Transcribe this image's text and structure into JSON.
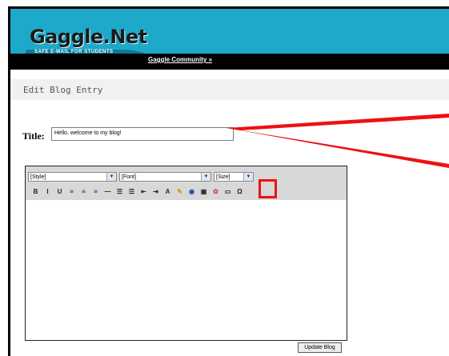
{
  "app": {
    "logo_text": "Gaggle.Net",
    "logo_tagline": "SAFE E-MAIL FOR STUDENTS",
    "nav_link": "Gaggle Community »"
  },
  "page": {
    "section_title": "Edit Blog Entry"
  },
  "form": {
    "title_label": "Title:",
    "title_value": "Hello, welcome to my blog!"
  },
  "editor": {
    "style_select": "[Style]",
    "font_select": "[Font]",
    "size_select": "[Size]",
    "dropdown_arrow": "▼",
    "toolbar_icons": [
      {
        "name": "bold-icon",
        "glyph": "B"
      },
      {
        "name": "italic-icon",
        "glyph": "I"
      },
      {
        "name": "underline-icon",
        "glyph": "U"
      },
      {
        "name": "align-left-icon",
        "glyph": "≡"
      },
      {
        "name": "align-center-icon",
        "glyph": "≡"
      },
      {
        "name": "align-right-icon",
        "glyph": "≡"
      },
      {
        "name": "horizontal-rule-icon",
        "glyph": "—"
      },
      {
        "name": "ordered-list-icon",
        "glyph": "☰"
      },
      {
        "name": "unordered-list-icon",
        "glyph": "☰"
      },
      {
        "name": "outdent-icon",
        "glyph": "⇤"
      },
      {
        "name": "indent-icon",
        "glyph": "⇥"
      },
      {
        "name": "text-color-icon",
        "glyph": "A"
      },
      {
        "name": "highlight-color-icon",
        "glyph": "✎"
      },
      {
        "name": "insert-link-icon",
        "glyph": "◉"
      },
      {
        "name": "insert-image-icon",
        "glyph": "▣"
      },
      {
        "name": "insert-smiley-icon",
        "glyph": "✿"
      },
      {
        "name": "insert-table-icon",
        "glyph": "▭"
      },
      {
        "name": "special-character-icon",
        "glyph": "Ω"
      }
    ]
  },
  "actions": {
    "update_button": "Update Blog"
  },
  "colors": {
    "header_bg": "#1da9c9",
    "annotation_red": "#ee1111"
  }
}
